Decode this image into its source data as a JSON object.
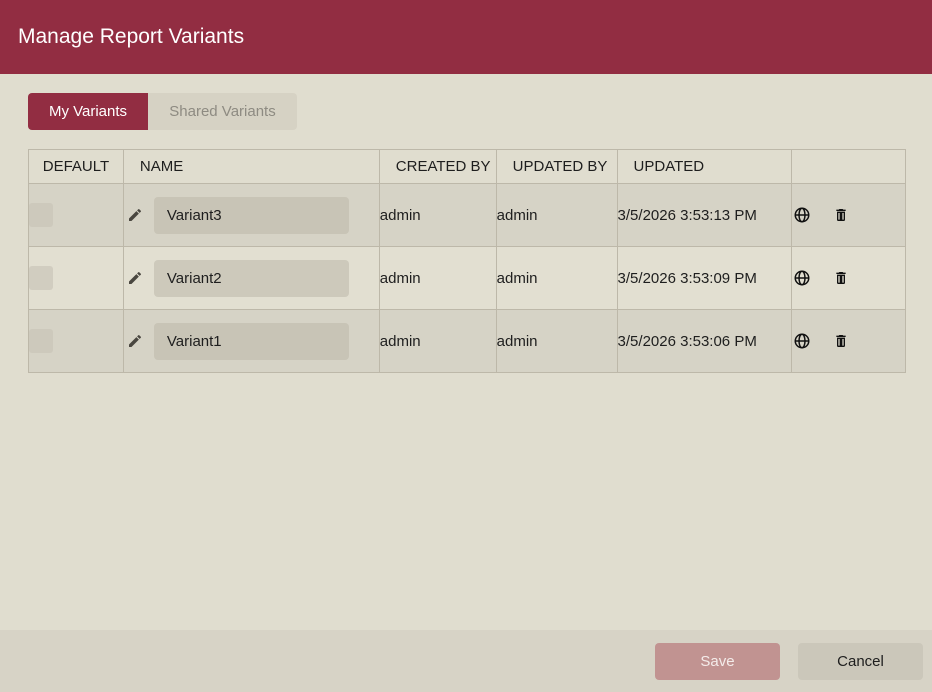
{
  "dialog": {
    "title": "Manage Report Variants"
  },
  "tabs": [
    {
      "label": "My Variants",
      "active": true
    },
    {
      "label": "Shared Variants",
      "active": false
    }
  ],
  "table": {
    "columns": {
      "default": "DEFAULT",
      "name": "NAME",
      "created_by": "CREATED BY",
      "updated_by": "UPDATED BY",
      "updated": "UPDATED"
    },
    "rows": [
      {
        "default": false,
        "name": "Variant3",
        "created_by": "admin",
        "updated_by": "admin",
        "updated": "3/5/2026 3:53:13 PM"
      },
      {
        "default": false,
        "name": "Variant2",
        "created_by": "admin",
        "updated_by": "admin",
        "updated": "3/5/2026 3:53:09 PM"
      },
      {
        "default": false,
        "name": "Variant1",
        "created_by": "admin",
        "updated_by": "admin",
        "updated": "3/5/2026 3:53:06 PM"
      }
    ]
  },
  "icons": {
    "edit": "pencil-icon",
    "share": "globe-icon",
    "delete": "trash-icon"
  },
  "footer": {
    "save_label": "Save",
    "cancel_label": "Cancel"
  },
  "colors": {
    "brand": "#922d42",
    "background": "#e0ddcf",
    "save_disabled": "#c19391"
  }
}
